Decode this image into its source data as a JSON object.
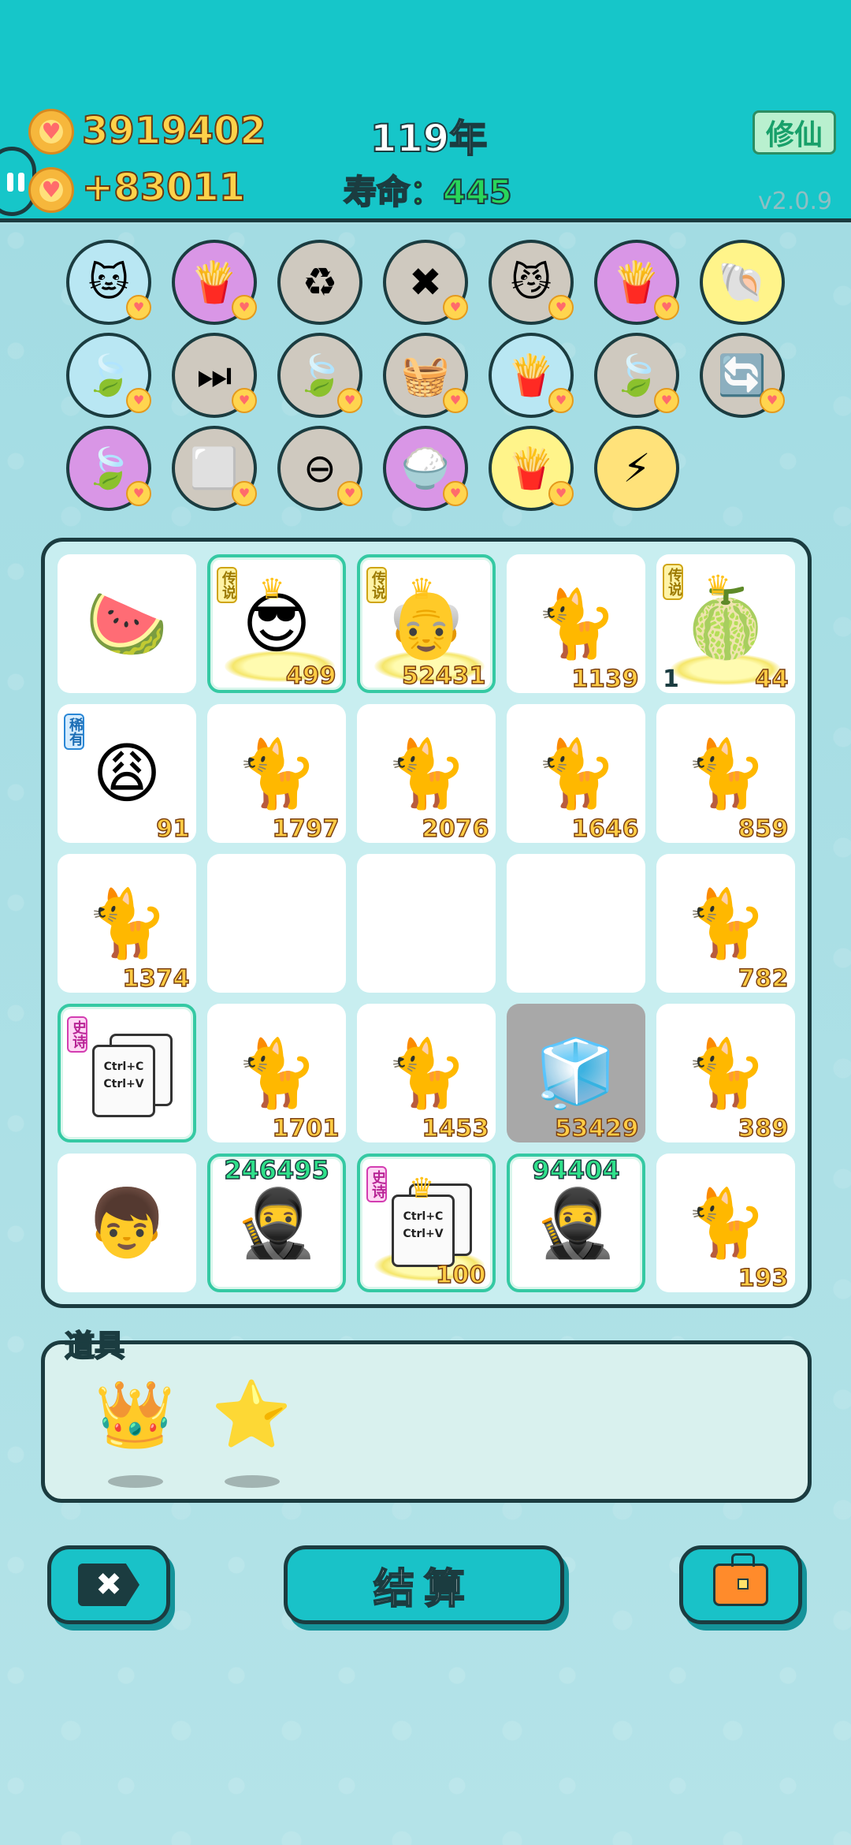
{
  "header": {
    "coins": "3919402",
    "income": "+83011",
    "year": "119年",
    "lifespan_label": "寿命：",
    "lifespan_value": "445",
    "cultivate_button": "修仙",
    "version": "v2.0.9"
  },
  "skills": [
    {
      "icon": "cat-face-icon",
      "glyph": "🐱",
      "bg": "#b9e7f3"
    },
    {
      "icon": "fries-icon",
      "glyph": "🍟",
      "bg": "#d996e6"
    },
    {
      "icon": "recycle-icon",
      "glyph": "♻",
      "bg": "#cfc9bf"
    },
    {
      "icon": "delete-tag-icon",
      "glyph": "✖",
      "bg": "#cfc9bf"
    },
    {
      "icon": "cats-pair-icon",
      "glyph": "😼",
      "bg": "#cfc9bf"
    },
    {
      "icon": "fries-icon",
      "glyph": "🍟",
      "bg": "#d996e6"
    },
    {
      "icon": "shell-icon",
      "glyph": "🐚",
      "bg": "#fff48a"
    },
    {
      "icon": "leaf-icon",
      "glyph": "🍃",
      "bg": "#b9e7f3"
    },
    {
      "icon": "skip-icon",
      "glyph": "⏭",
      "bg": "#cfc9bf"
    },
    {
      "icon": "leaf-icon",
      "glyph": "🍃",
      "bg": "#cfc9bf"
    },
    {
      "icon": "fruit-basket-icon",
      "glyph": "🧺",
      "bg": "#cfc9bf"
    },
    {
      "icon": "fries-icon",
      "glyph": "🍟",
      "bg": "#b9e7f3"
    },
    {
      "icon": "leaf-icon",
      "glyph": "🍃",
      "bg": "#cfc9bf"
    },
    {
      "icon": "refresh-icon",
      "glyph": "🔄",
      "bg": "#cfc9bf"
    },
    {
      "icon": "leaf-icon",
      "glyph": "🍃",
      "bg": "#d996e6"
    },
    {
      "icon": "dice-icon",
      "glyph": "⬜",
      "bg": "#cfc9bf"
    },
    {
      "icon": "minus-circle-icon",
      "glyph": "⊖",
      "bg": "#cfc9bf"
    },
    {
      "icon": "rice-bowl-icon",
      "glyph": "🍚",
      "bg": "#d996e6"
    },
    {
      "icon": "fries-icon",
      "glyph": "🍟",
      "bg": "#fff48a"
    },
    {
      "icon": "lightning-icon",
      "glyph": "⚡",
      "bg": "#ffe27a"
    }
  ],
  "board": {
    "cells": [
      {
        "icon": "watermelon-icon",
        "glyph": "🍉",
        "num": ""
      },
      {
        "icon": "king-sunglasses-icon",
        "glyph": "😎",
        "num": "499",
        "badge": "传说",
        "badge_type": "legend",
        "framed": true,
        "crown": true
      },
      {
        "icon": "king-grandpa-icon",
        "glyph": "👴",
        "num": "52431",
        "badge": "传说",
        "badge_type": "legend",
        "framed": true,
        "crown": true
      },
      {
        "icon": "cat-icon",
        "glyph": "🐈",
        "num": "1139"
      },
      {
        "icon": "pomelo-icon",
        "glyph": "🍈",
        "num": "44",
        "num_left": "1",
        "badge": "传说",
        "badge_type": "legend",
        "crown": true
      },
      {
        "icon": "hat-man-icon",
        "glyph": "😩",
        "num": "91",
        "badge": "稀有",
        "badge_type": "rare"
      },
      {
        "icon": "cat-icon",
        "glyph": "🐈",
        "num": "1797"
      },
      {
        "icon": "cat-icon",
        "glyph": "🐈",
        "num": "2076"
      },
      {
        "icon": "cat-icon",
        "glyph": "🐈",
        "num": "1646"
      },
      {
        "icon": "cat-icon",
        "glyph": "🐈",
        "num": "859"
      },
      {
        "icon": "cat-icon",
        "glyph": "🐈",
        "num": "1374"
      },
      {
        "icon": "",
        "glyph": "",
        "num": ""
      },
      {
        "icon": "",
        "glyph": "",
        "num": ""
      },
      {
        "icon": "",
        "glyph": "",
        "num": ""
      },
      {
        "icon": "cat-icon",
        "glyph": "🐈",
        "num": "782"
      },
      {
        "icon": "copy-paste-icon",
        "glyph": "",
        "num": "",
        "badge": "史诗",
        "badge_type": "epic",
        "framed": true,
        "doc": true
      },
      {
        "icon": "cat-icon",
        "glyph": "🐈",
        "num": "1701"
      },
      {
        "icon": "cat-icon",
        "glyph": "🐈",
        "num": "1453"
      },
      {
        "icon": "fridge-icon",
        "glyph": "🧊",
        "num": "53429",
        "gray": true
      },
      {
        "icon": "cat-icon",
        "glyph": "🐈",
        "num": "389"
      },
      {
        "icon": "boy-face-icon",
        "glyph": "👦",
        "num": ""
      },
      {
        "icon": "thief-icon",
        "glyph": "🥷",
        "num_top": "246495",
        "num": "",
        "framed": true
      },
      {
        "icon": "copy-paste-icon",
        "glyph": "",
        "num": "100",
        "badge": "史诗",
        "badge_type": "epic",
        "framed": true,
        "doc": true,
        "crown": true
      },
      {
        "icon": "thief-icon",
        "glyph": "🥷",
        "num_top": "94404",
        "num": "",
        "framed": true
      },
      {
        "icon": "cat-icon",
        "glyph": "🐈",
        "num": "193"
      }
    ],
    "doc_text_1": "Ctrl+C",
    "doc_text_2": "Ctrl+V"
  },
  "tools": {
    "title": "道具",
    "items": [
      {
        "icon": "crown-icon",
        "glyph": "👑"
      },
      {
        "icon": "star-icon",
        "glyph": "⭐"
      }
    ]
  },
  "actions": {
    "discard_glyph": "✖",
    "settle_label": "结算"
  },
  "colors": {
    "header_bg": "#16c6c9",
    "board_border": "#1b3c40",
    "gold_text": "#ffd24a",
    "life_text": "#28d65a"
  }
}
